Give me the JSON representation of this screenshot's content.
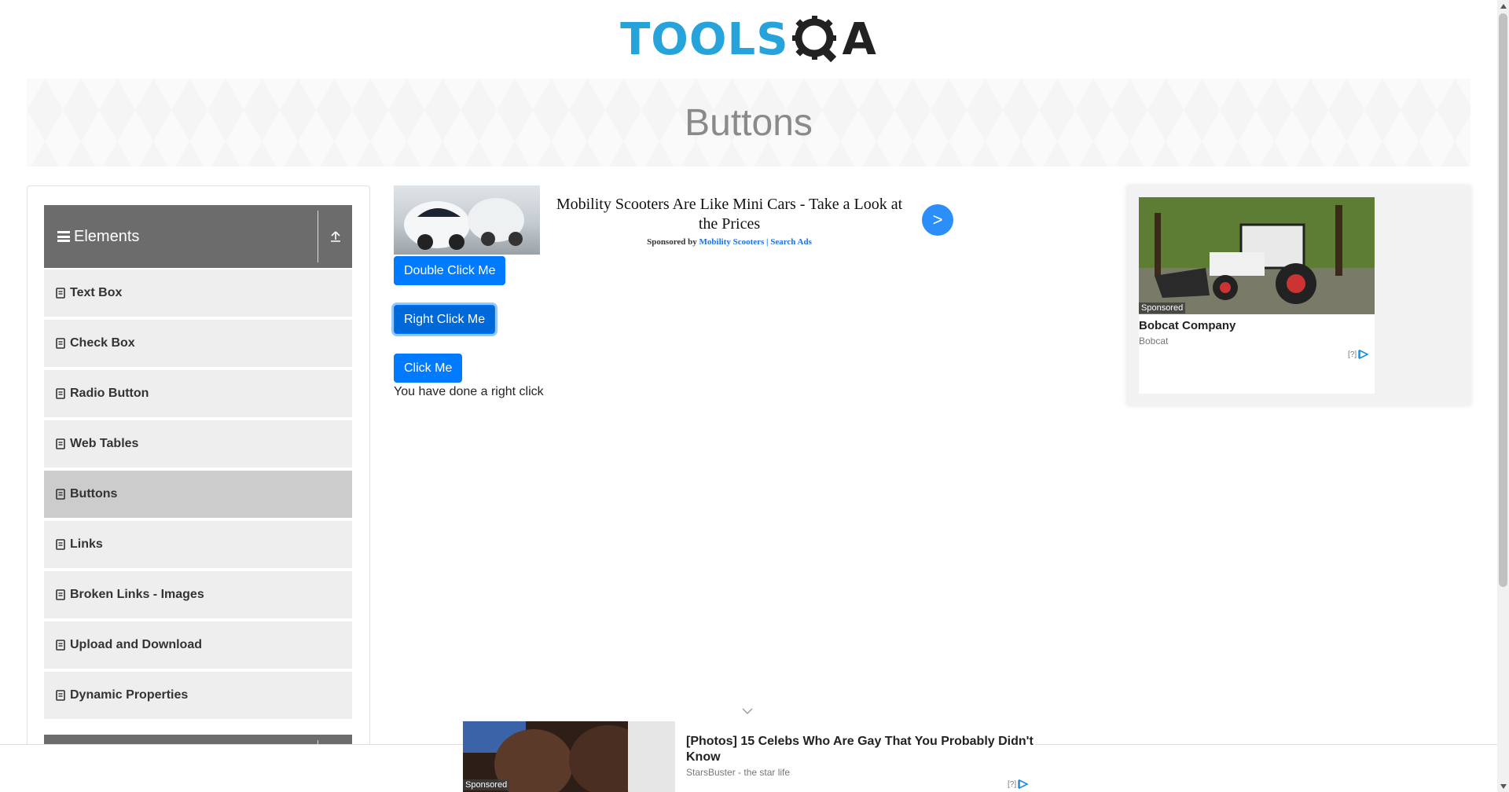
{
  "header": {
    "logo_text": "TOOLS",
    "logo_letter": "A"
  },
  "banner": {
    "title": "Buttons"
  },
  "sidebar": {
    "group_title": "Elements",
    "items": [
      {
        "label": "Text Box"
      },
      {
        "label": "Check Box"
      },
      {
        "label": "Radio Button"
      },
      {
        "label": "Web Tables"
      },
      {
        "label": "Buttons",
        "active": true
      },
      {
        "label": "Links"
      },
      {
        "label": "Broken Links - Images"
      },
      {
        "label": "Upload and Download"
      },
      {
        "label": "Dynamic Properties"
      }
    ]
  },
  "ad_top": {
    "headline": "Mobility Scooters Are Like Mini Cars - Take a Look at the Prices",
    "sponsor_prefix": "Sponsored by",
    "sponsor_name": "Mobility Scooters | Search Ads",
    "arrow": ">"
  },
  "buttons": {
    "double_click": "Double Click Me",
    "right_click": "Right Click Me",
    "click": "Click Me"
  },
  "result_message": "You have done a right click",
  "ad_right": {
    "sponsored_label": "Sponsored",
    "company": "Bobcat Company",
    "brand": "Bobcat",
    "help": "[?]"
  },
  "ad_bottom": {
    "sponsored_label": "Sponsored",
    "headline": "[Photos] 15 Celebs Who Are Gay That You Probably Didn't Know",
    "source": "StarsBuster - the star life",
    "help": "[?]"
  },
  "colors": {
    "primary_button": "#007bff",
    "sidebar_header": "#6c6c6c",
    "sidebar_item": "#eeeeee",
    "sidebar_active": "#cccccc",
    "logo_blue": "#27a3db"
  }
}
